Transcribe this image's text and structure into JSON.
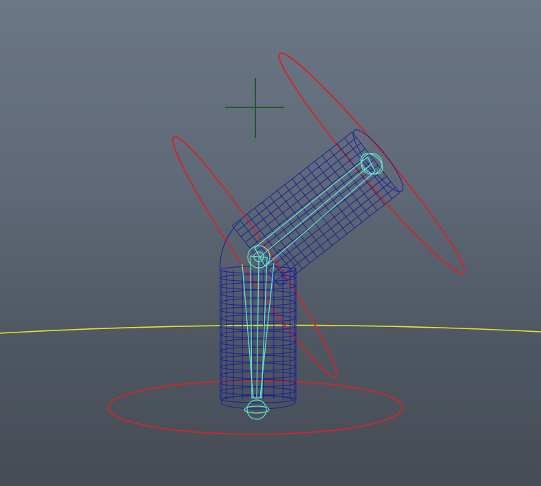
{
  "viewport": {
    "view": "perspective"
  },
  "colors": {
    "background_top": "#6c7786",
    "background_bottom": "#454c56",
    "ground_grid": "#e6e62a",
    "control_curve": "#c92a2a",
    "mesh_wireframe": "#1a1f9c",
    "joints": "#5fe6c8",
    "locator": "#1f5a2c"
  },
  "icons": {
    "locator": "crosshair-locator-icon"
  },
  "scene": {
    "objects": [
      {
        "name": "ground-grid-line",
        "kind": "grid"
      },
      {
        "name": "root-control-curve",
        "kind": "nurbs-circle"
      },
      {
        "name": "elbow-control-curve",
        "kind": "nurbs-circle"
      },
      {
        "name": "end-control-curve",
        "kind": "nurbs-circle"
      },
      {
        "name": "cylinder-mesh",
        "kind": "polygon-wireframe"
      },
      {
        "name": "joint-chain",
        "kind": "skeleton",
        "joint_count": 3
      },
      {
        "name": "pole-vector-locator",
        "kind": "locator"
      }
    ]
  }
}
